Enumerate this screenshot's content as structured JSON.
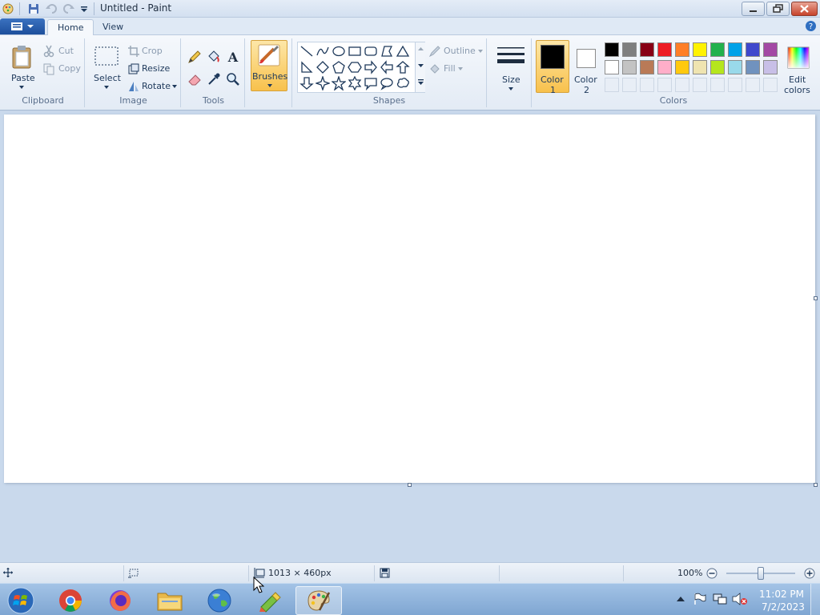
{
  "window": {
    "title": "Untitled - Paint"
  },
  "tabs": [
    {
      "label": "Home"
    },
    {
      "label": "View"
    }
  ],
  "ribbon": {
    "clipboard": {
      "group_label": "Clipboard",
      "paste": "Paste",
      "cut": "Cut",
      "copy": "Copy"
    },
    "image": {
      "group_label": "Image",
      "select": "Select",
      "crop": "Crop",
      "resize": "Resize",
      "rotate": "Rotate"
    },
    "tools": {
      "group_label": "Tools"
    },
    "brushes": {
      "label": "Brushes"
    },
    "shapes": {
      "group_label": "Shapes",
      "outline": "Outline",
      "fill": "Fill"
    },
    "size": {
      "label": "Size"
    },
    "colors": {
      "group_label": "Colors",
      "color1_a": "Color",
      "color1_b": "1",
      "color2_a": "Color",
      "color2_b": "2",
      "edit_a": "Edit",
      "edit_b": "colors",
      "color1_value": "#000000",
      "color2_value": "#ffffff",
      "palette_row1": [
        "#000000",
        "#7f7f7f",
        "#880015",
        "#ed1c24",
        "#ff7f27",
        "#fff200",
        "#22b14c",
        "#00a2e8",
        "#3f48cc",
        "#a349a4"
      ],
      "palette_row2": [
        "#ffffff",
        "#c3c3c3",
        "#b97a57",
        "#ffaec9",
        "#ffc90e",
        "#efe4b0",
        "#b5e61d",
        "#99d9ea",
        "#7092be",
        "#c8bfe7"
      ]
    }
  },
  "status": {
    "dimensions": "1013 × 460px",
    "zoom": "100%"
  },
  "tray": {
    "time": "11:02 PM",
    "date": "7/2/2023"
  }
}
